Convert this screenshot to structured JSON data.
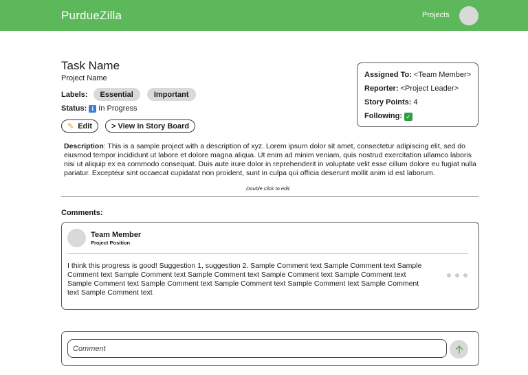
{
  "app": {
    "brand": "PurdueZilla"
  },
  "nav": {
    "projects_label": "Projects"
  },
  "task": {
    "name": "Task Name",
    "project_name": "Project Name",
    "labels_key": "Labels:",
    "labels": [
      "Essential",
      "Important"
    ],
    "status_key": "Status:",
    "status_value": "In Progress",
    "status_icon": "info-icon",
    "edit_label": "Edit",
    "story_board_label": "View in Story Board"
  },
  "details": {
    "assigned_key": "Assigned To:",
    "assigned_value": "<Team Member>",
    "reporter_key": "Reporter:",
    "reporter_value": "<Project Leader>",
    "story_points_key": "Story Points:",
    "story_points_value": "4",
    "following_key": "Following:",
    "following_icon": "checkmark-icon"
  },
  "description": {
    "key": "Description",
    "text": ": This is a sample project with a description of xyz. Lorem ipsum dolor sit amet, consectetur adipiscing elit, sed do eiusmod tempor incididunt ut labore et dolore magna aliqua. Ut enim ad minim veniam, quis nostrud exercitation ullamco laboris nisi ut aliquip ex ea commodo consequat. Duis aute irure dolor in reprehenderit in voluptate velit esse cillum dolore eu fugiat nulla pariatur. Excepteur sint occaecat cupidatat non proident, sunt in culpa qui officia deserunt mollit anim id est laborum.",
    "edit_hint": "Double click to edit."
  },
  "comments": {
    "heading": "Comments:",
    "items": [
      {
        "author": "Team Member",
        "position": "Project Position",
        "text": "I think this progress is good! Suggestion 1, suggestion 2. Sample Comment text Sample Comment text Sample Comment text Sample Comment text Sample Comment text Sample Comment text Sample Comment text Sample Comment text Sample Comment text Sample Comment text Sample Comment text Sample Comment text Sample Comment text"
      }
    ],
    "input_placeholder": "Comment"
  },
  "colors": {
    "brand_green": "#5cb85a",
    "send_arrow": "#5cb85a",
    "chip_bg": "#d9d9d9"
  }
}
